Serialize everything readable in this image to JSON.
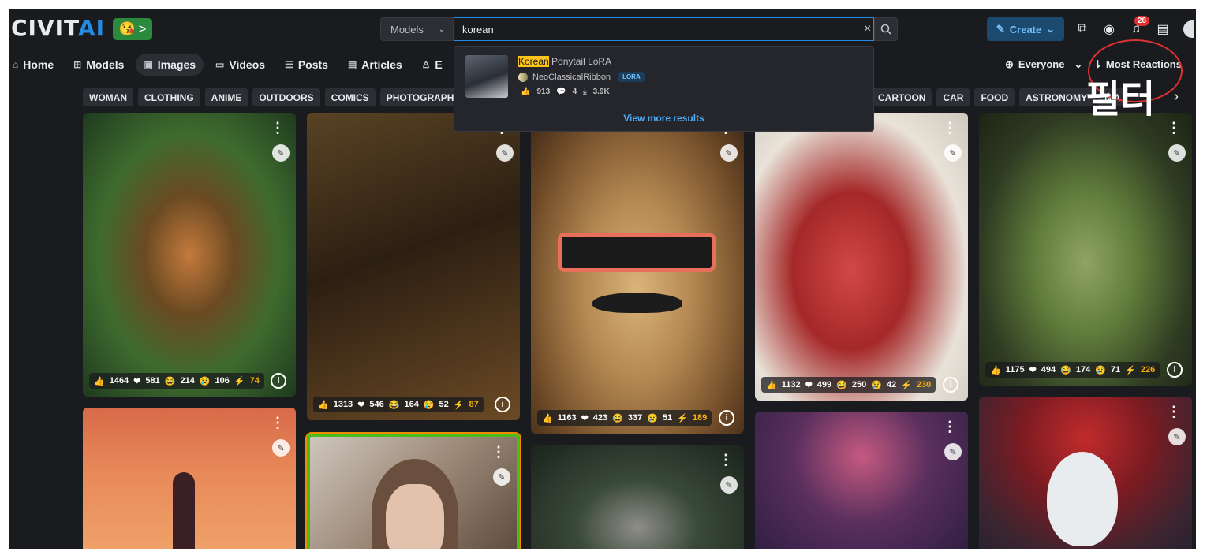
{
  "header": {
    "logo_main": "CIVIT",
    "logo_accent": "AI",
    "emoji_chevron": ">",
    "search_type": "Models",
    "search_value": "korean",
    "search_clear": "×",
    "create_label": "Create",
    "notification_count": "26"
  },
  "nav": {
    "items": [
      {
        "label": "Home",
        "icon": "home-icon"
      },
      {
        "label": "Models",
        "icon": "models-icon"
      },
      {
        "label": "Images",
        "icon": "images-icon",
        "active": true
      },
      {
        "label": "Videos",
        "icon": "videos-icon"
      },
      {
        "label": "Posts",
        "icon": "posts-icon"
      },
      {
        "label": "Articles",
        "icon": "articles-icon"
      },
      {
        "label": "E",
        "icon": "bounties-icon"
      }
    ],
    "visibility_label": "Everyone",
    "sort_label": "Most Reactions"
  },
  "annotation": {
    "text": "필터",
    "color": "#e03131"
  },
  "tags": {
    "left": [
      "WOMAN",
      "CLOTHING",
      "ANIME",
      "OUTDOORS",
      "COMICS",
      "PHOTOGRAPHY"
    ],
    "right": [
      "CARTOON",
      "CAR",
      "FOOD",
      "ASTRONOMY"
    ],
    "partial": "N A"
  },
  "search_dropdown": {
    "result_title_highlight": "Korean",
    "result_title_rest": " Ponytail LoRA",
    "result_user": "NeoClassicalRibbon",
    "result_badge": "LORA",
    "result_likes": "913",
    "result_comments": "4",
    "result_downloads": "3.9K",
    "view_more": "View more results"
  },
  "cards": [
    {
      "likes": "1464",
      "hearts": "581",
      "laughs": "214",
      "cries": "106",
      "buzz": "74"
    },
    {
      "likes": "1313",
      "hearts": "546",
      "laughs": "164",
      "cries": "52",
      "buzz": "87"
    },
    {
      "likes": "1163",
      "hearts": "423",
      "laughs": "337",
      "cries": "51",
      "buzz": "189"
    },
    {
      "likes": "1132",
      "hearts": "499",
      "laughs": "250",
      "cries": "42",
      "buzz": "230"
    },
    {
      "likes": "1175",
      "hearts": "494",
      "laughs": "174",
      "cries": "71",
      "buzz": "226"
    }
  ],
  "colors": {
    "brand": "#228be6",
    "background": "#1a1b1e",
    "highlight_border": "#4cbc1c"
  }
}
